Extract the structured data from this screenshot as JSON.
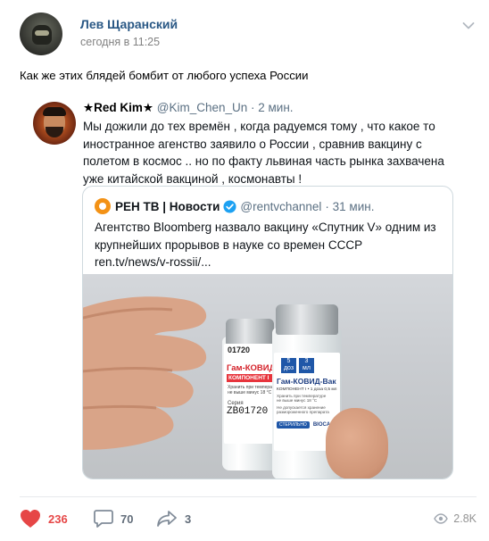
{
  "post": {
    "author": "Лев Щаранский",
    "time": "сегодня в 11:25",
    "text": "Как же этих блядей бомбит от любого успеха России"
  },
  "tweet": {
    "name": "★Red Kim★",
    "handle": "@Kim_Chen_Un",
    "time": "· 2 мин.",
    "text": "Мы дожили до тех времён , когда радуемся тому , что какое то иностранное агенство заявило о России , сравнив вакцину с полетом в космос .. но по факту львиная часть рынка захвачена уже китайской вакциной , космонавты !"
  },
  "quote": {
    "name": "РЕН ТВ | Новости",
    "handle": "@rentvchannel",
    "time": "· 31 мин.",
    "text": "Агентство Bloomberg назвало вакцину «Спутник V» одним из крупнейших прорывов в науке со времен СССР",
    "link": "ren.tv/news/v-rossii/..."
  },
  "photo": {
    "left_vial": {
      "top_code": "01720",
      "title": "Гам-КОВИД",
      "component": "КОМПОНЕНТ I",
      "small1": "Хранить при темпера-",
      "small2": "не выше минус 18 °C",
      "series": "Серия",
      "code": "ZB01720"
    },
    "right_vial": {
      "dose_num": "5",
      "dose_label": "доз",
      "ml_num": "3",
      "ml_label": "мл",
      "title": "Гам-КОВИД-Вак",
      "component": "КОМПОНЕНТ I • 1 доза 0,5 мл",
      "small1": "Хранить при температуре",
      "small2": "не выше минус 18 °C",
      "small3": "Не допускается хранение",
      "small4": "размороженного препарата",
      "sterile": "СТЕРИЛЬНО",
      "brand": "BIOCAD"
    }
  },
  "actions": {
    "likes": "236",
    "comments": "70",
    "shares": "3",
    "views": "2.8K"
  },
  "colors": {
    "author_link": "#2a5885",
    "like_red": "#e64646",
    "muted": "#626d7a",
    "twitter_blue": "#1da1f2"
  }
}
